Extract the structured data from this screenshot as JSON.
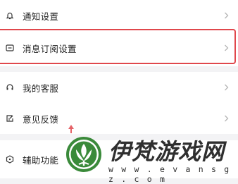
{
  "menu": {
    "items": [
      {
        "label": "通知设置",
        "icon": "bell-icon"
      },
      {
        "label": "消息订阅设置",
        "icon": "message-square-icon"
      },
      {
        "label": "我的客服",
        "icon": "headset-icon"
      },
      {
        "label": "意见反馈",
        "icon": "edit-note-icon"
      },
      {
        "label": "辅助功能",
        "icon": "accessibility-shield-icon"
      }
    ]
  },
  "watermark": {
    "title": "伊梵游戏网",
    "url": "w w w . e v a n s g z . c o m"
  },
  "colors": {
    "highlight_border": "#e0474c",
    "watermark_green": "#3a8a3a"
  }
}
